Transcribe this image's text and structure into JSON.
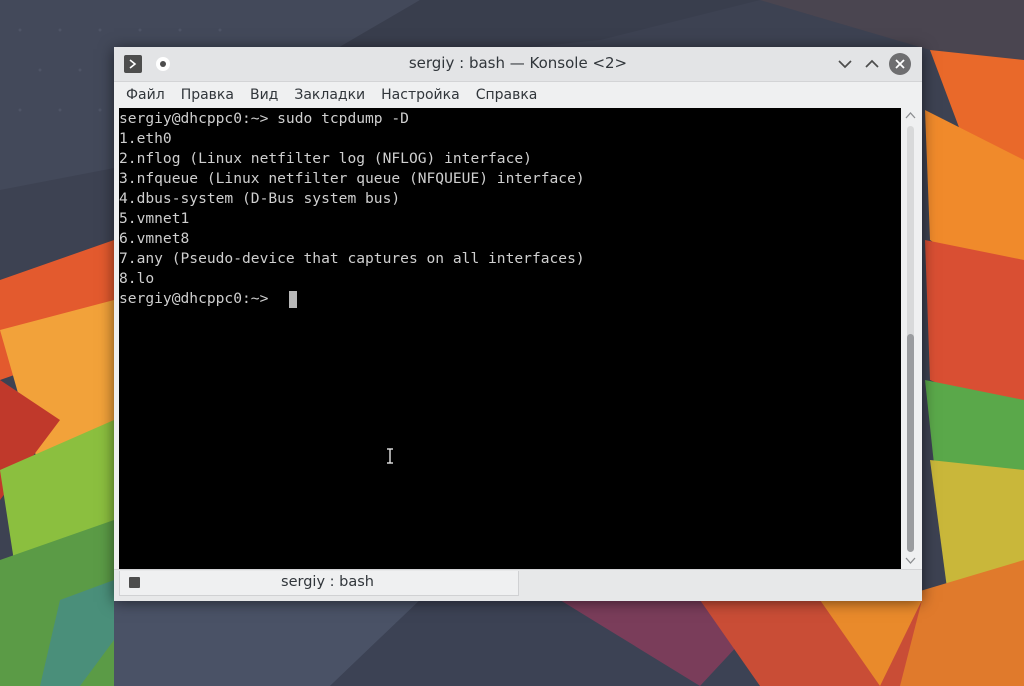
{
  "window": {
    "title": "sergiy : bash — Konsole <2>",
    "icons": {
      "app": "konsole-icon",
      "pin": "pin-icon",
      "minimize": "chevron-down-icon",
      "maximize": "chevron-up-icon",
      "close": "close-icon"
    }
  },
  "menu": {
    "items": [
      "Файл",
      "Правка",
      "Вид",
      "Закладки",
      "Настройка",
      "Справка"
    ]
  },
  "terminal": {
    "lines": [
      "sergiy@dhcppc0:~> sudo tcpdump -D",
      "1.eth0",
      "2.nflog (Linux netfilter log (NFLOG) interface)",
      "3.nfqueue (Linux netfilter queue (NFQUEUE) interface)",
      "4.dbus-system (D-Bus system bus)",
      "5.vmnet1",
      "6.vmnet8",
      "7.any (Pseudo-device that captures on all interfaces)",
      "8.lo",
      "sergiy@dhcppc0:~> "
    ],
    "scroll_position": 1.0
  },
  "tabs": [
    {
      "label": "sergiy : bash",
      "icon": "terminal-icon",
      "active": true
    }
  ],
  "colors": {
    "terminal_bg": "#000000",
    "terminal_fg": "#cfcfcf",
    "chrome_bg": "#eff0f1",
    "text": "#31363b"
  }
}
